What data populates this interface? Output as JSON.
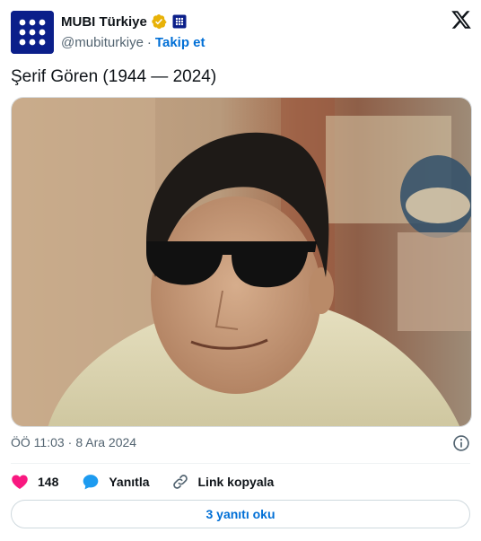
{
  "author": {
    "display_name": "MUBI Türkiye",
    "handle": "@mubiturkiye",
    "separator": "·",
    "follow_label": "Takip et",
    "avatar_icon": "mubi-dots-logo-icon",
    "verified_color": "#e8b208",
    "affiliate_color": "#0b1f8a"
  },
  "tweet": {
    "text": "Şerif Gören (1944 — 2024)",
    "photo_alt": "Sepia portrait photo of a man wearing dark sunglasses, looking down"
  },
  "meta": {
    "time": "ÖÖ 11:03",
    "separator": "·",
    "date": "8 Ara 2024"
  },
  "actions": {
    "likes_count": "148",
    "reply_label": "Yanıtla",
    "copy_link_label": "Link kopyala"
  },
  "footer": {
    "read_replies_label": "3 yanıtı oku"
  },
  "colors": {
    "like": "#f91880",
    "reply": "#1d9bf0",
    "link_blue": "#006fd6"
  }
}
